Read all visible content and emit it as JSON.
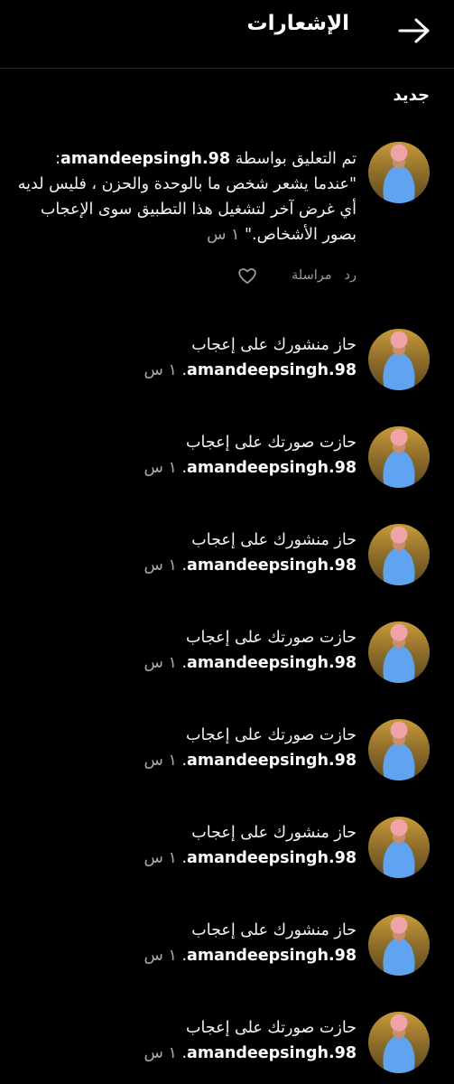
{
  "header": {
    "title": "الإشعارات",
    "back_icon": "arrow-right-icon"
  },
  "section": {
    "title": "جديد"
  },
  "comment": {
    "prefix": "تم التعليق بواسطة",
    "user": "amandeepsingh.98",
    "body": ": \"عندما يشعر شخص ما بالوحدة والحزن ، فليس لديه أي غرض آخر لتشغيل هذا التطبيق سوى الإعجاب بصور الأشخاص.\"",
    "time": "١ س",
    "reply_label": "رد",
    "message_label": "مراسلة",
    "like_icon": "heart-icon"
  },
  "notifications": [
    {
      "prefix": "حاز منشورك على إعجاب",
      "user": "amandeepsingh.98",
      "suffix": ".",
      "time": "١ س"
    },
    {
      "prefix": "حازت صورتك على إعجاب",
      "user": "amandeepsingh.98",
      "suffix": ".",
      "time": "١ س"
    },
    {
      "prefix": "حاز منشورك على إعجاب",
      "user": "amandeepsingh.98",
      "suffix": ".",
      "time": "١ س"
    },
    {
      "prefix": "حازت صورتك على إعجاب",
      "user": "amandeepsingh.98",
      "suffix": ".",
      "time": "١ س"
    },
    {
      "prefix": "حازت صورتك على إعجاب",
      "user": "amandeepsingh.98",
      "suffix": ".",
      "time": "١ س"
    },
    {
      "prefix": "حاز منشورك على إعجاب",
      "user": "amandeepsingh.98",
      "suffix": ".",
      "time": "١ س"
    },
    {
      "prefix": "حاز منشورك على إعجاب",
      "user": "amandeepsingh.98",
      "suffix": ".",
      "time": "١ س"
    },
    {
      "prefix": "حازت صورتك على إعجاب",
      "user": "amandeepsingh.98",
      "suffix": ".",
      "time": "١ س"
    }
  ]
}
